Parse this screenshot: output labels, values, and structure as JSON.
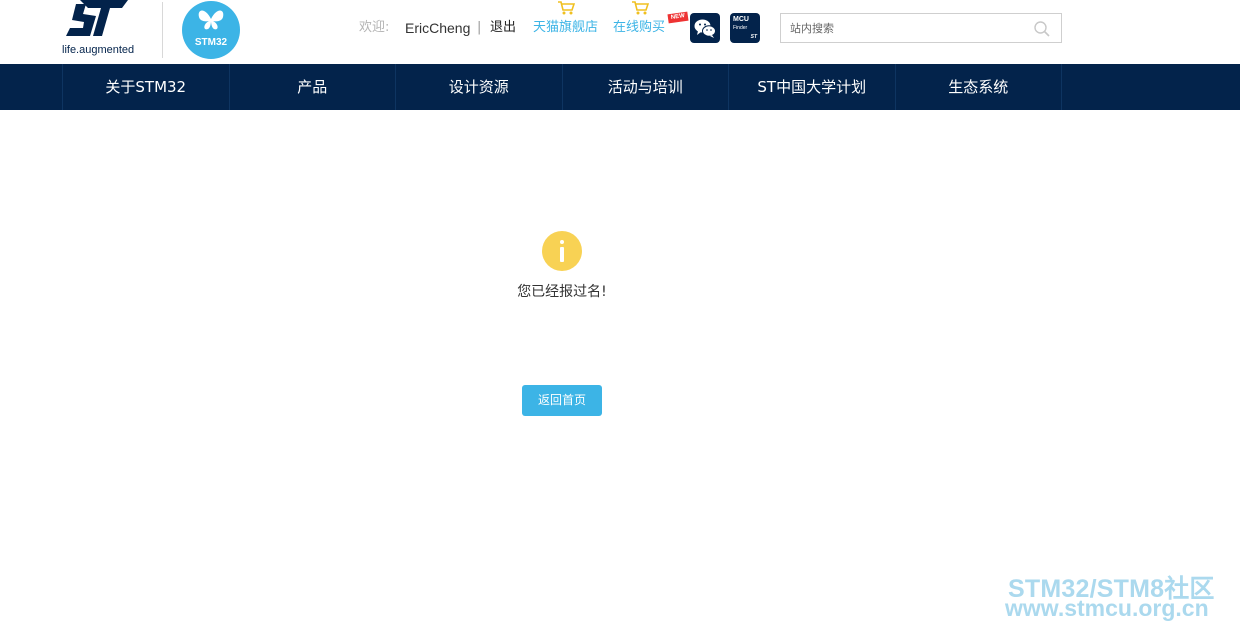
{
  "header": {
    "st_logo_tagline": "life.augmented",
    "stm32_logo_text": "STM32",
    "welcome_label": "欢迎:",
    "username": "EricCheng",
    "separator": "|",
    "logout_label": "退出",
    "tmall_link": "天猫旗舰店",
    "online_shop_link": "在线购买",
    "new_badge": "NEW",
    "mcu_finder": {
      "line1": "MCU",
      "line2": "Finder",
      "brand": "ST"
    },
    "search_placeholder": "站内搜索"
  },
  "nav": {
    "items": [
      "关于STM32",
      "产品",
      "设计资源",
      "活动与培训",
      "ST中国大学计划",
      "生态系统"
    ]
  },
  "main": {
    "message": "您已经报过名!",
    "back_button": "返回首页"
  },
  "watermark": {
    "line1": "STM32/STM8社区",
    "line2": "www.stmcu.org.cn"
  },
  "colors": {
    "nav_bg": "#03234b",
    "accent": "#3cb4e6",
    "info_icon": "#f8d254"
  }
}
